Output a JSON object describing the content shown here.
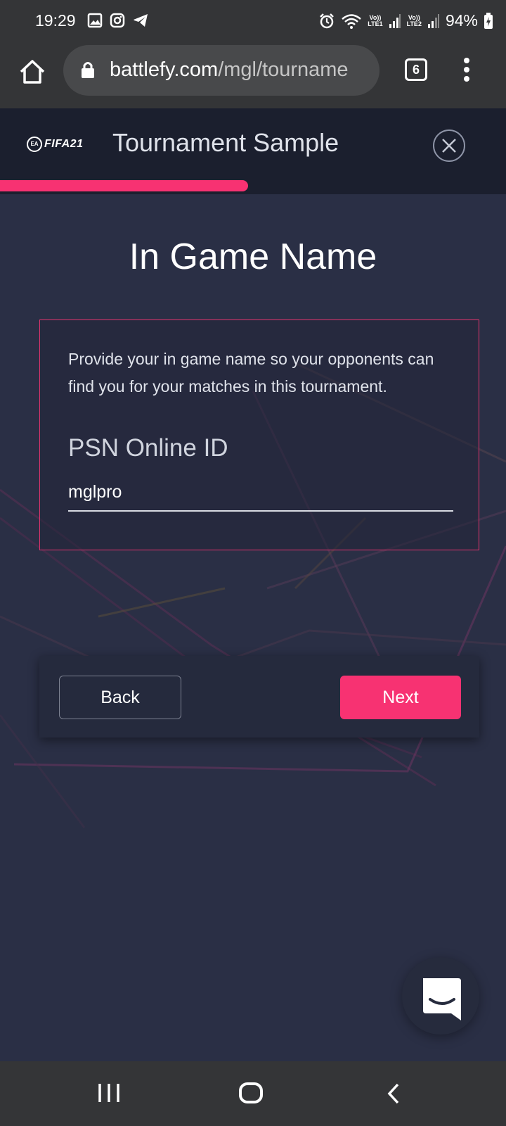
{
  "status_bar": {
    "time": "19:29",
    "sim1_top": "Vo))",
    "sim1_bottom": "LTE1",
    "sim2_top": "Vo))",
    "sim2_bottom": "LTE2",
    "battery": "94%",
    "icons": [
      "gallery-icon",
      "instagram-icon",
      "telegram-icon",
      "alarm-icon",
      "wifi-icon",
      "signal-icon",
      "battery-charging-icon"
    ]
  },
  "browser": {
    "url_domain": "battlefy.com",
    "url_path": "/mgl/tourname",
    "tab_count": "6"
  },
  "header": {
    "logo_badge": "EA",
    "logo_text": "FIFA21",
    "title": "Tournament Sample",
    "progress_fraction": 0.49
  },
  "main": {
    "title": "In Game Name",
    "description": "Provide your in game name so your opponents can find you for your matches in this tournament.",
    "field_label": "PSN Online ID",
    "field_value": "mglpro"
  },
  "actions": {
    "back_label": "Back",
    "next_label": "Next"
  },
  "colors": {
    "accent": "#f73272",
    "background": "#2a2f45",
    "header_bg": "#1b1f2e",
    "chrome_bg": "#343537"
  }
}
